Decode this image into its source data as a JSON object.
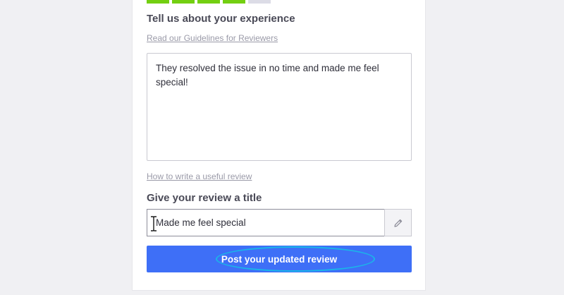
{
  "rating": {
    "filled": 4,
    "total": 5
  },
  "experience": {
    "heading": "Tell us about your experience",
    "guidelines_link": "Read our Guidelines for Reviewers",
    "review_text": "They resolved the issue in no time and made me feel special!",
    "useful_link": "How to write a useful review"
  },
  "title_section": {
    "heading": "Give your review a title",
    "title_value": "Made me feel special"
  },
  "submit": {
    "label": "Post your updated review"
  },
  "colors": {
    "star_filled": "#73cf11",
    "star_empty": "#dcdce6",
    "button": "#3e6ff7",
    "highlight": "#1ab6e8"
  },
  "icons": [
    "pencil-icon",
    "text-cursor-icon"
  ]
}
